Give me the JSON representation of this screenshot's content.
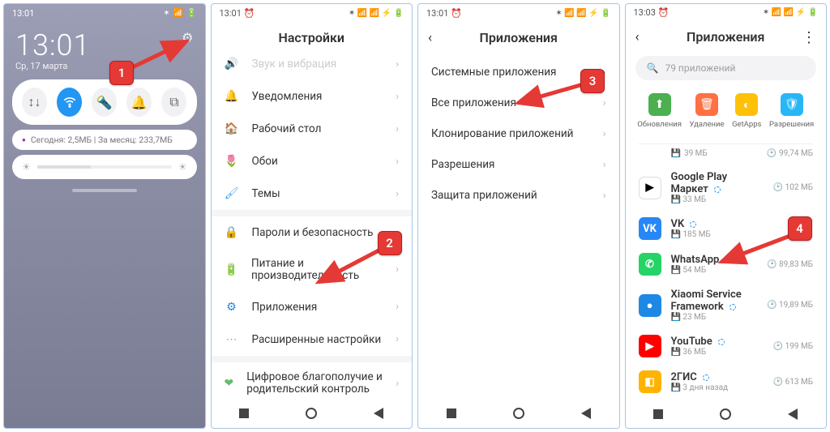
{
  "panel1": {
    "status_time": "13:01",
    "date": "Ср, 17 марта",
    "data_pill": "Сегодня: 2,5МБ   |   За месяц: 233,7МБ",
    "callout": "1"
  },
  "panel2": {
    "status_time": "13:01",
    "header": "Настройки",
    "callout": "2",
    "items": {
      "audio": "Звук и вибрация",
      "notif": "Уведомления",
      "home": "Рабочий стол",
      "wall": "Обои",
      "theme": "Темы",
      "sec": "Пароли и безопасность",
      "power": "Питание и производительность",
      "apps": "Приложения",
      "ext": "Расширенные настройки",
      "well": "Цифровое благополучие и родительский контроль"
    }
  },
  "panel3": {
    "status_time": "13:01",
    "header": "Приложения",
    "callout": "3",
    "items": {
      "sys": "Системные приложения",
      "all": "Все приложения",
      "clone": "Клонирование приложений",
      "perm": "Разрешения",
      "protect": "Защита приложений"
    }
  },
  "panel4": {
    "status_time": "13:03",
    "header": "Приложения",
    "search_placeholder": "79 приложений",
    "callout": "4",
    "chips": {
      "upd": "Обновления",
      "del": "Удаление",
      "get": "GetApps",
      "perm": "Разрешения"
    },
    "peek": {
      "size": "39 МБ",
      "time": "99,74 МБ"
    },
    "apps": [
      {
        "name": "Google Play Маркет",
        "size": "33 МБ",
        "time": "102 МБ",
        "color": "#fff",
        "fg": "#000",
        "glyph": "▶"
      },
      {
        "name": "VK",
        "size": "185 МБ",
        "time": "",
        "color": "#2787f5",
        "glyph": "VK"
      },
      {
        "name": "WhatsApp",
        "size": "54 МБ",
        "time": "89,83 МБ",
        "color": "#25d366",
        "glyph": "✆"
      },
      {
        "name": "Xiaomi Service Framework",
        "size": "23 МБ",
        "time": "19,89 МБ",
        "color": "#1e88e5",
        "glyph": "●"
      },
      {
        "name": "YouTube",
        "size": "36 МБ",
        "time": "199 МБ",
        "color": "#ff0000",
        "glyph": "▶"
      },
      {
        "name": "2ГИС",
        "size": "3 дня назад",
        "time": "613 МБ",
        "color": "#ffb300",
        "glyph": "◧"
      }
    ]
  }
}
